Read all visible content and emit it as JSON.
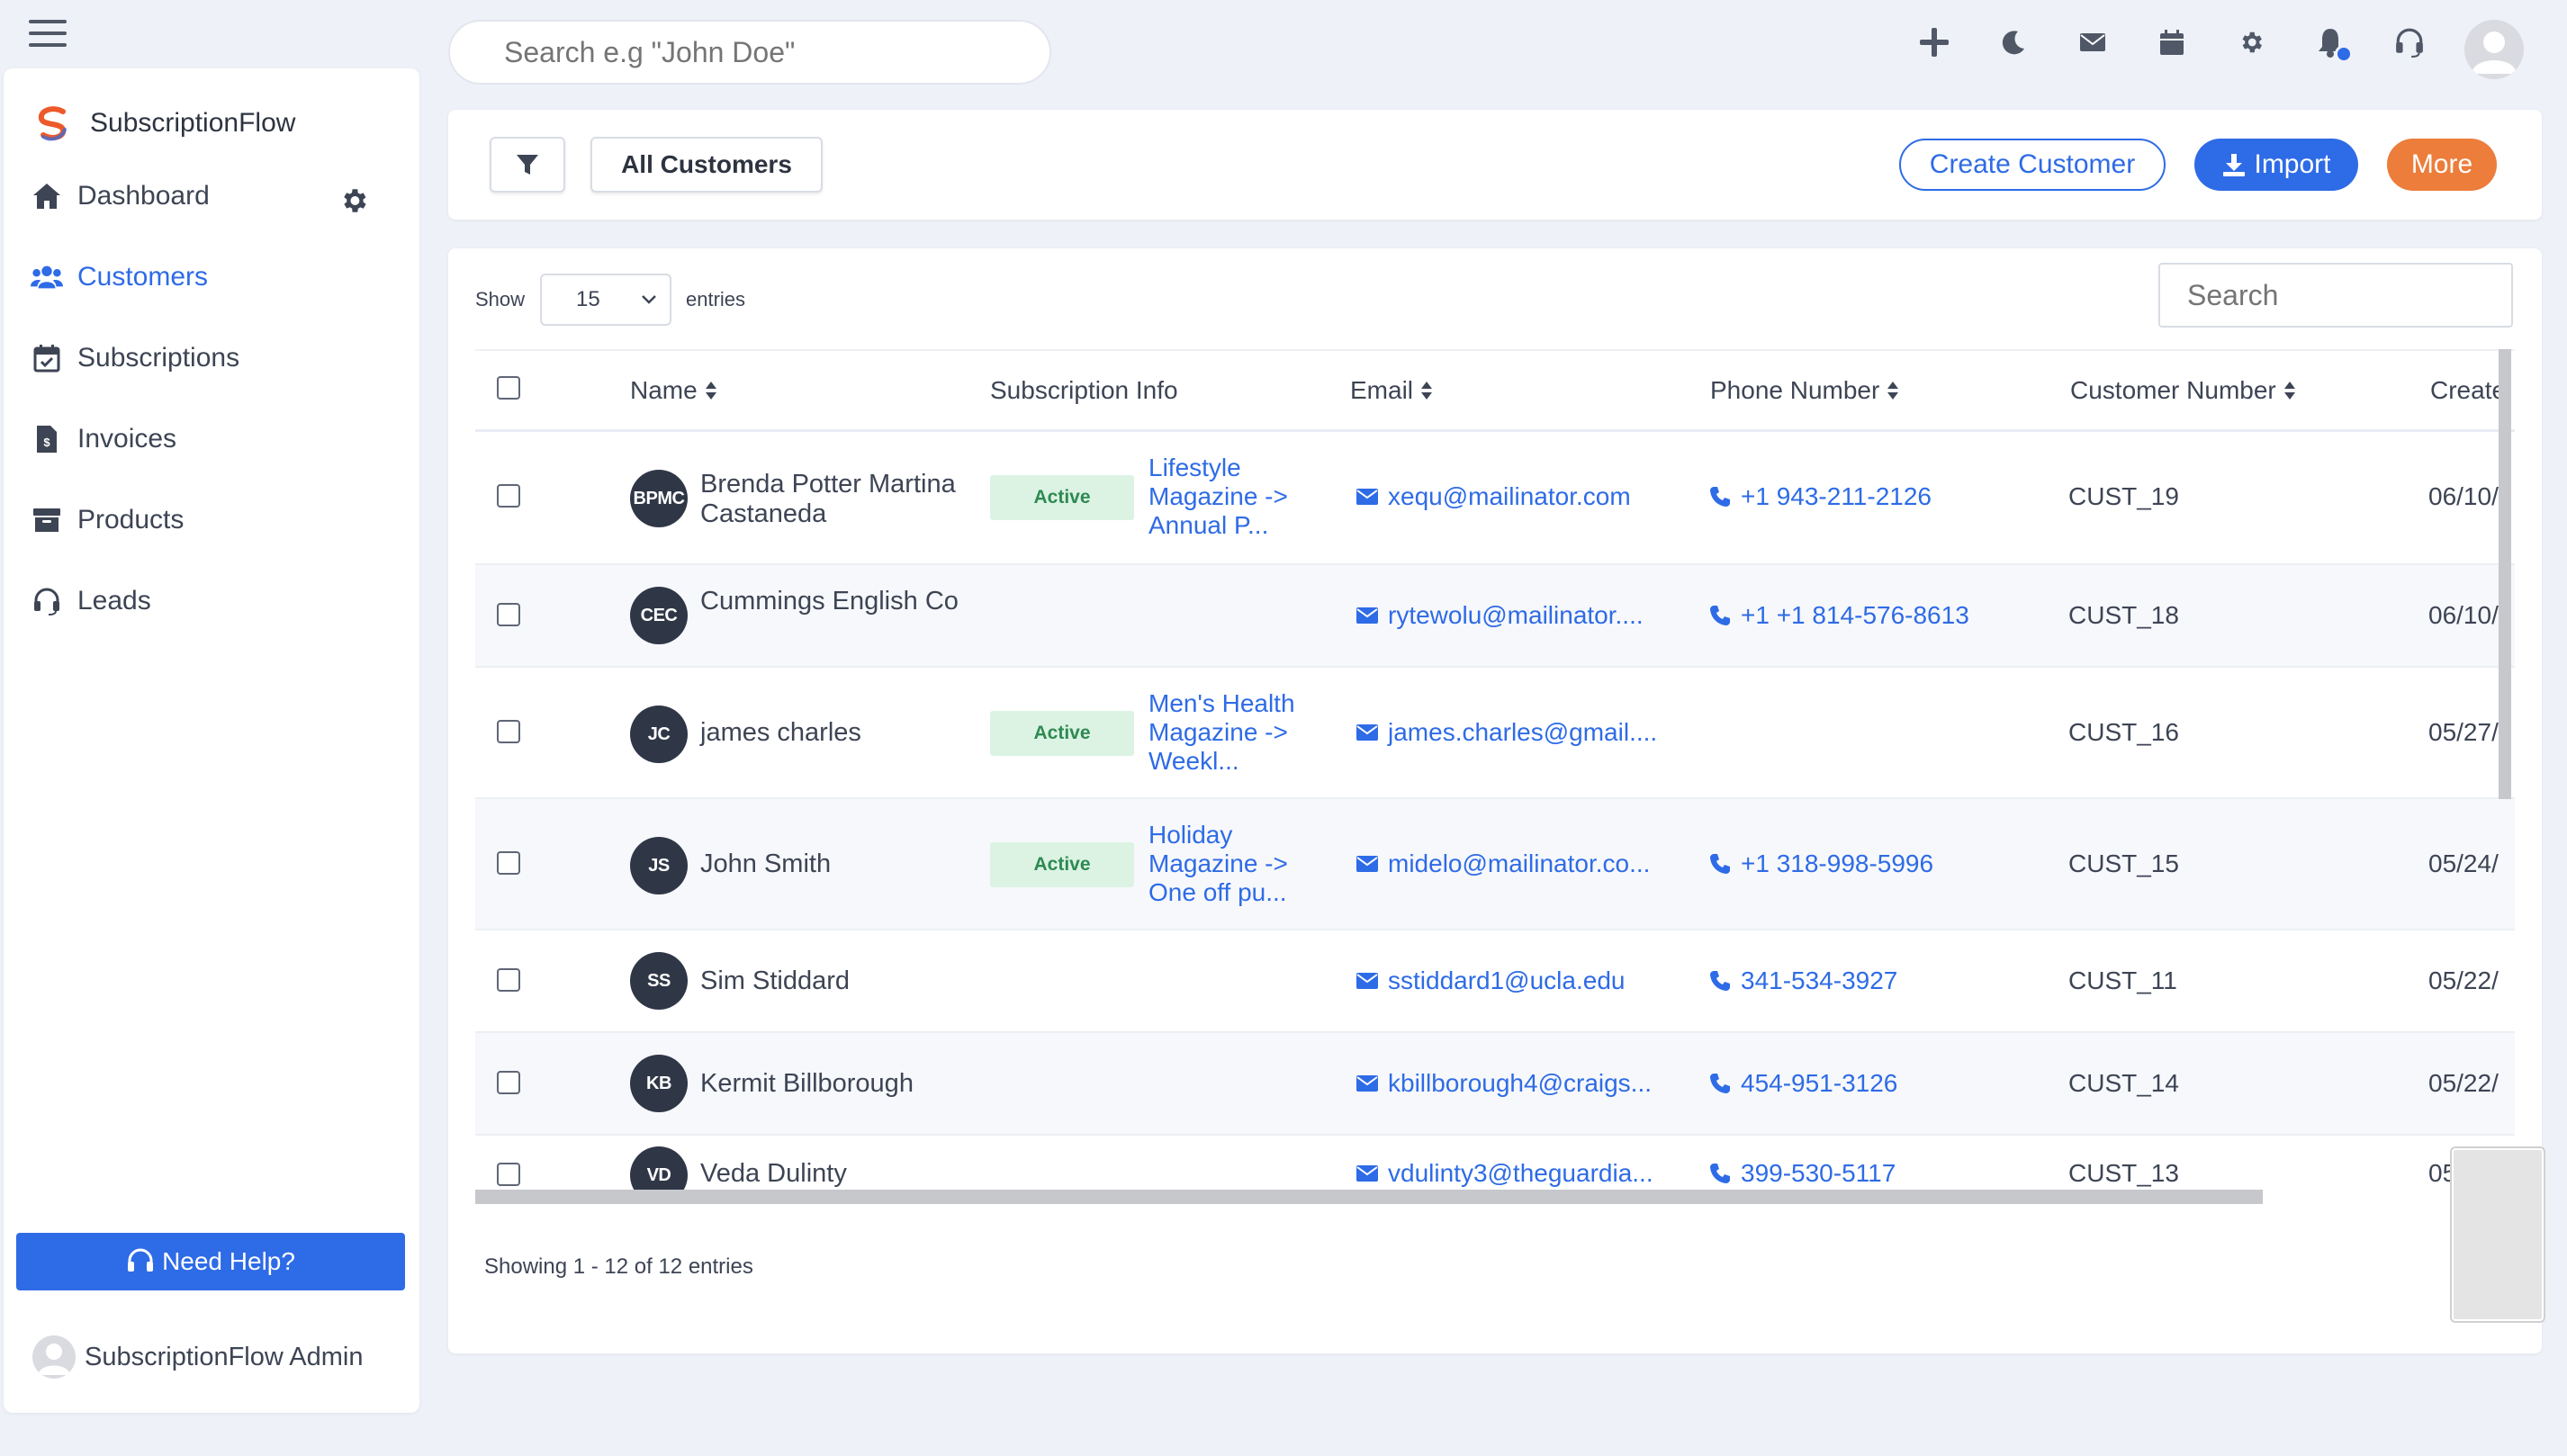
{
  "brand": {
    "name": "SubscriptionFlow"
  },
  "sidebar": {
    "items": [
      {
        "label": "Dashboard",
        "icon": "home-icon"
      },
      {
        "label": "Customers",
        "icon": "users-icon",
        "active": true
      },
      {
        "label": "Subscriptions",
        "icon": "calendar-check-icon"
      },
      {
        "label": "Invoices",
        "icon": "invoice-icon"
      },
      {
        "label": "Products",
        "icon": "archive-icon"
      },
      {
        "label": "Leads",
        "icon": "headset-icon"
      }
    ],
    "help_label": "Need Help?",
    "admin_name": "SubscriptionFlow Admin"
  },
  "topbar": {
    "search_placeholder": "Search e.g \"John Doe\"",
    "icons": [
      "plus-icon",
      "moon-icon",
      "mail-icon",
      "calendar-icon",
      "gear-icon",
      "bell-icon",
      "headset-icon"
    ]
  },
  "toolbar": {
    "view_label": "All Customers",
    "create_label": "Create Customer",
    "import_label": "Import",
    "more_label": "More"
  },
  "table": {
    "show_label": "Show",
    "page_size": "15",
    "entries_label": "entries",
    "search_placeholder": "Search",
    "headers": {
      "name": "Name",
      "subscription": "Subscription Info",
      "email": "Email",
      "phone": "Phone Number",
      "customer_number": "Customer Number",
      "created": "Create"
    },
    "rows": [
      {
        "initials": "BPMC",
        "name": "Brenda Potter Martina Castaneda",
        "status": "Active",
        "plan": "Lifestyle Magazine -> Annual P...",
        "email": "xequ@mailinator.com",
        "phone": "+1 943-211-2126",
        "customer_number": "CUST_19",
        "created": "06/10/"
      },
      {
        "initials": "CEC",
        "name": "Cummings English Co",
        "status": "",
        "plan": "",
        "email": "rytewolu@mailinator....",
        "phone": "+1 +1 814-576-8613",
        "customer_number": "CUST_18",
        "created": "06/10/"
      },
      {
        "initials": "JC",
        "name": "james charles",
        "status": "Active",
        "plan": "Men's Health Magazine -> Weekl...",
        "email": "james.charles@gmail....",
        "phone": "",
        "customer_number": "CUST_16",
        "created": "05/27/"
      },
      {
        "initials": "JS",
        "name": "John Smith",
        "status": "Active",
        "plan": "Holiday Magazine -> One off pu...",
        "email": "midelo@mailinator.co...",
        "phone": "+1 318-998-5996",
        "customer_number": "CUST_15",
        "created": "05/24/"
      },
      {
        "initials": "SS",
        "name": "Sim Stiddard",
        "status": "",
        "plan": "",
        "email": "sstiddard1@ucla.edu",
        "phone": "341-534-3927",
        "customer_number": "CUST_11",
        "created": "05/22/"
      },
      {
        "initials": "KB",
        "name": "Kermit Billborough",
        "status": "",
        "plan": "",
        "email": "kbillborough4@craigs...",
        "phone": "454-951-3126",
        "customer_number": "CUST_14",
        "created": "05/22/"
      },
      {
        "initials": "VD",
        "name": "Veda Dulinty",
        "status": "",
        "plan": "",
        "email": "vdulinty3@theguardia...",
        "phone": "399-530-5117",
        "customer_number": "CUST_13",
        "created": "05/"
      }
    ],
    "footer": "Showing 1 - 12 of 12 entries"
  },
  "colors": {
    "accent": "#2e6be6",
    "orange": "#ec7d3b",
    "active_bg": "#dcf3e4",
    "active_text": "#2e8a52",
    "avatar_bg": "#2f3747"
  }
}
